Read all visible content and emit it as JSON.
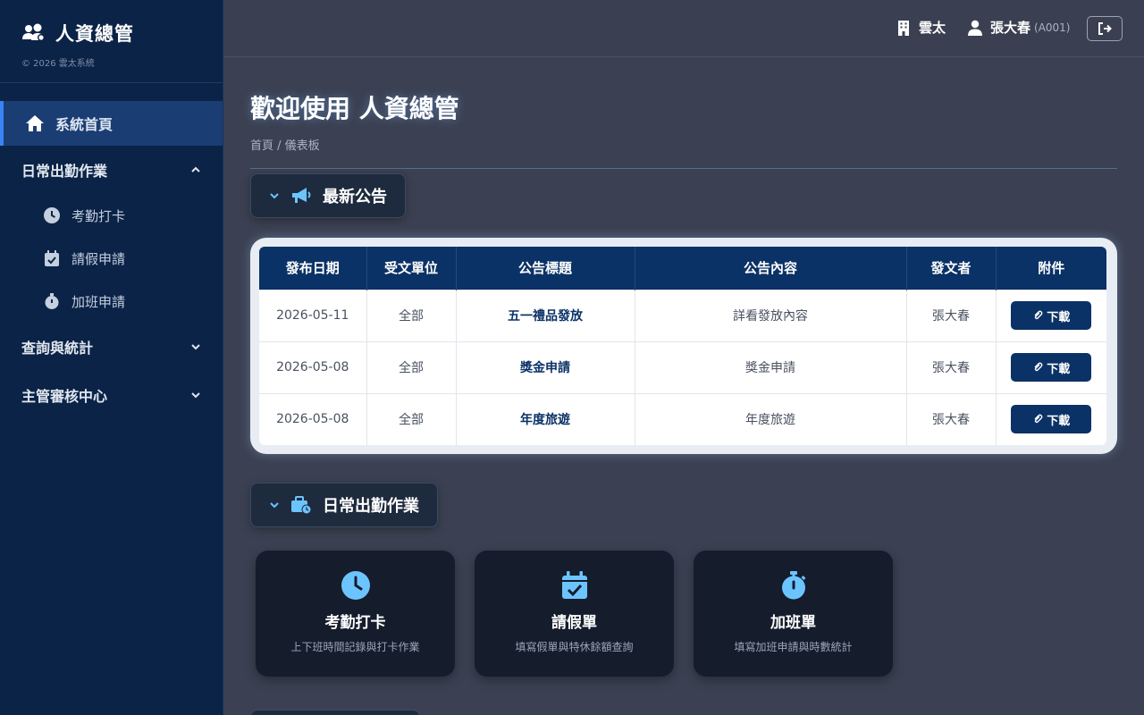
{
  "brand": {
    "title": "人資總管",
    "copyright": "© 2026 雲太系統"
  },
  "sidebar": {
    "home": "系統首頁",
    "groups": [
      {
        "label": "日常出勤作業",
        "expanded": true,
        "items": [
          "考勤打卡",
          "請假申請",
          "加班申請"
        ]
      },
      {
        "label": "查詢與統計",
        "expanded": false
      },
      {
        "label": "主管審核中心",
        "expanded": false
      }
    ]
  },
  "topbar": {
    "company": "雲太",
    "user_name": "張大春",
    "user_id": "(A001)"
  },
  "page": {
    "title": "歡迎使用 人資總管",
    "breadcrumb": "首頁 / 儀表板"
  },
  "announcements": {
    "section_label": "最新公告",
    "columns": [
      "發布日期",
      "受文單位",
      "公告標題",
      "公告內容",
      "發文者",
      "附件"
    ],
    "rows": [
      {
        "date": "2026-05-11",
        "unit": "全部",
        "title": "五一禮品發放",
        "content": "詳看發放內容",
        "author": "張大春",
        "attachment": "下載"
      },
      {
        "date": "2026-05-08",
        "unit": "全部",
        "title": "獎金申請",
        "content": "獎金申請",
        "author": "張大春",
        "attachment": "下載"
      },
      {
        "date": "2026-05-08",
        "unit": "全部",
        "title": "年度旅遊",
        "content": "年度旅遊",
        "author": "張大春",
        "attachment": "下載"
      }
    ]
  },
  "daily": {
    "section_label": "日常出勤作業",
    "cards": [
      {
        "title": "考勤打卡",
        "desc": "上下班時間記錄與打卡作業",
        "icon": "clock-icon"
      },
      {
        "title": "請假單",
        "desc": "填寫假單與特休餘額查詢",
        "icon": "calendar-check-icon"
      },
      {
        "title": "加班單",
        "desc": "填寫加班申請與時數統計",
        "icon": "stopwatch-icon"
      }
    ]
  },
  "colors": {
    "accent": "#3b82f6",
    "navy": "#0b3266",
    "sidebar": "#0b2347",
    "icon_blue": "#6cc4ff"
  }
}
